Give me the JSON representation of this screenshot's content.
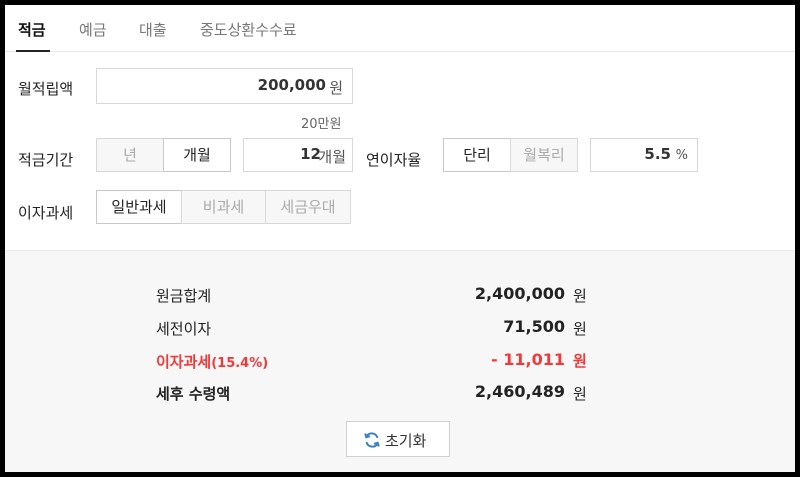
{
  "tabs": [
    {
      "label": "적금",
      "active": true
    },
    {
      "label": "예금",
      "active": false
    },
    {
      "label": "대출",
      "active": false
    },
    {
      "label": "중도상환수수료",
      "active": false
    }
  ],
  "form": {
    "monthly_label": "월적립액",
    "monthly_value": "200,000",
    "monthly_unit": "원",
    "monthly_hint": "20만원",
    "period_label": "적금기간",
    "period_options": [
      "년",
      "개월"
    ],
    "period_selected": "개월",
    "period_value": "12",
    "period_unit": "개월",
    "rate_label": "연이자율",
    "rate_options": [
      "단리",
      "월복리"
    ],
    "rate_selected": "단리",
    "rate_value": "5.5",
    "rate_unit": "%",
    "tax_label": "이자과세",
    "tax_options": [
      "일반과세",
      "비과세",
      "세금우대"
    ],
    "tax_selected": "일반과세"
  },
  "results": {
    "principal_label": "원금합계",
    "principal_value": "2,400,000",
    "principal_unit": "원",
    "pretax_label": "세전이자",
    "pretax_value": "71,500",
    "pretax_unit": "원",
    "tax_label": "이자과세",
    "tax_rate": "(15.4%)",
    "tax_value": "- 11,011",
    "tax_unit": "원",
    "net_label": "세후 수령액",
    "net_value": "2,460,489",
    "net_unit": "원"
  },
  "reset_label": "초기화",
  "colors": {
    "accent_red": "#f03a3a",
    "refresh_blue": "#3b82c4"
  },
  "icons": {
    "reset": "refresh-icon"
  }
}
